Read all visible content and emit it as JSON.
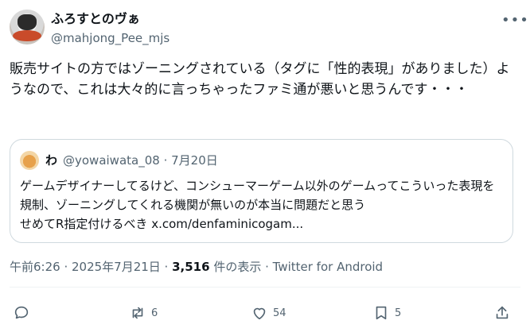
{
  "author": {
    "name": "ふろすとのヴぁ",
    "handle": "@mahjong_Pee_mjs"
  },
  "tweet": {
    "text": "販売サイトの方ではゾーニングされている（タグに「性的表現」がありました）ようなので、これは大々的に言っちゃったファミ通が悪いと思うんです・・・"
  },
  "quote": {
    "name": "わ",
    "meta": "@yowaiwata_08 · 7月20日",
    "text": "ゲームデザイナーしてるけど、コンシューマーゲーム以外のゲームってこういった表現を規制、ゾーニングしてくれる機関が無いのが本当に問題だと思う\nせめてR指定付けるべき x.com/denfaminicogam..."
  },
  "meta": {
    "time": "午前6:26 · 2025年7月21日 · ",
    "views": "3,516",
    "views_label": " 件の表示 · Twitter for Android"
  },
  "actions": {
    "reply_icon": "reply-icon",
    "retweets": "6",
    "likes": "54",
    "bookmarks": "5"
  },
  "colors": {
    "text": "#0f1419",
    "secondary": "#536471",
    "border": "#cfd9de"
  }
}
